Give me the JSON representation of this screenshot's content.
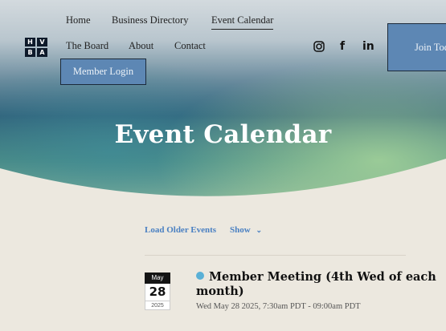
{
  "nav": {
    "row1": [
      "Home",
      "Business Directory",
      "Event Calendar"
    ],
    "row2": [
      "The Board",
      "About",
      "Contact"
    ],
    "member_login": "Member Login",
    "join": "Join Today"
  },
  "logo_letters": [
    "H",
    "V",
    "B",
    "A"
  ],
  "social": {
    "instagram": "instagram-icon",
    "facebook": "f",
    "linkedin": "in"
  },
  "colors": {
    "accent": "#5d87b4",
    "link": "#4a80c2",
    "event_dot": "#5ab0d6",
    "page_bg": "#ece8df"
  },
  "page_title": "Event Calendar",
  "controls": {
    "load_older": "Load Older Events",
    "show": "Show"
  },
  "events": [
    {
      "month": "May",
      "day": "28",
      "year": "2025",
      "title": "Member Meeting (4th Wed of each month)",
      "time": "Wed May 28 2025, 7:30am PDT - 09:00am PDT"
    }
  ]
}
